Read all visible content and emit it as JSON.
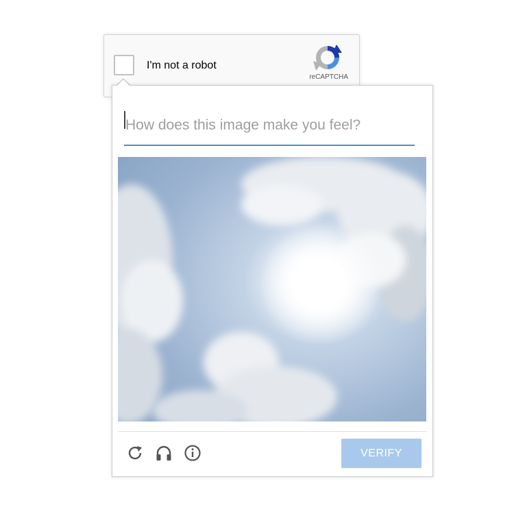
{
  "anchor": {
    "checkbox_label": "I'm not a robot",
    "brand": "reCAPTCHA",
    "logo_icon": "recaptcha-logo-icon"
  },
  "challenge": {
    "placeholder": "How does this image make you feel?",
    "value": "",
    "image_alt": "sky-with-sun-and-clouds",
    "footer": {
      "reload_icon": "reload-icon",
      "audio_icon": "headphones-icon",
      "info_icon": "info-icon",
      "verify_label": "VERIFY"
    }
  },
  "colors": {
    "accent_underline": "#4a90c8",
    "verify_button": "#a9c9ec",
    "logo_blue": "#1c3aa9",
    "logo_light_blue": "#4a90e2",
    "logo_gray": "#b4b4b4"
  }
}
